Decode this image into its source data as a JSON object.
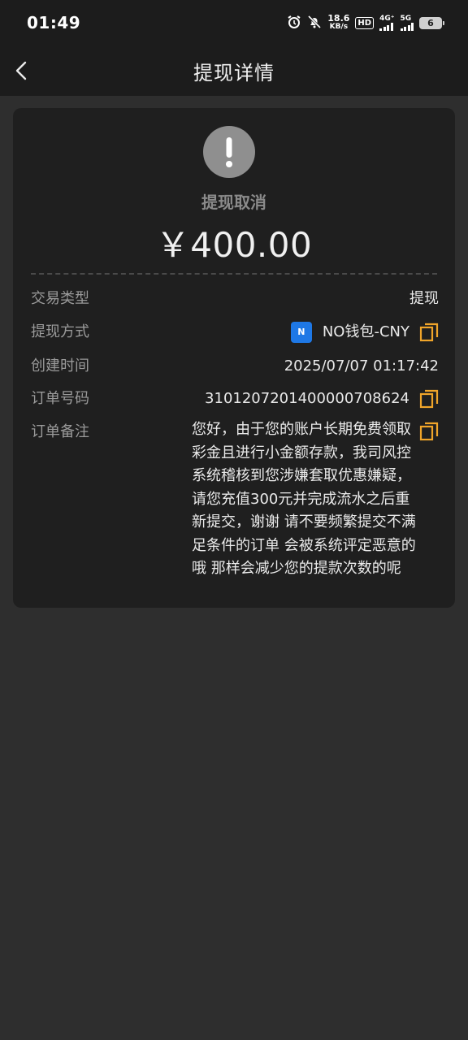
{
  "status_bar": {
    "time": "01:49",
    "net_speed_value": "18.6",
    "net_speed_unit": "KB/s",
    "hd_badge": "HD",
    "network_1": "4G⁺",
    "network_2": "5G",
    "battery": "6",
    "icons": [
      "alarm-icon",
      "mute-icon"
    ]
  },
  "header": {
    "title": "提现详情",
    "back_icon": "chevron-left-icon"
  },
  "transaction": {
    "status_icon": "exclamation-icon",
    "status_label": "提现取消",
    "amount": "￥400.00",
    "fields": {
      "type_label": "交易类型",
      "type_value": "提现",
      "method_label": "提现方式",
      "method_logo": "N",
      "method_value": "NO钱包-CNY",
      "created_label": "创建时间",
      "created_value": "2025/07/07 01:17:42",
      "order_label": "订单号码",
      "order_value": "3101207201400000708624",
      "note_label": "订单备注",
      "note_value": "您好，由于您的账户长期免费领取彩金且进行小金额存款，我司风控系统稽核到您涉嫌套取优惠嫌疑，请您充值300元并完成流水之后重新提交，谢谢 请不要频繁提交不满足条件的订单 会被系统评定恶意的哦 那样会减少您的提款次数的呢"
    }
  },
  "colors": {
    "background": "#2e2e2e",
    "card": "#1f1f1f",
    "accent_copy": "#f0a52a",
    "wallet_logo": "#1e78e6"
  }
}
